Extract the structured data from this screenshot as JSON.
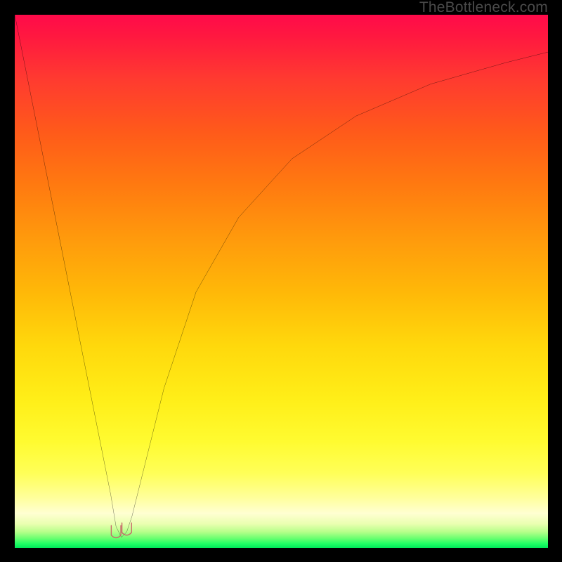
{
  "watermark": {
    "text": "TheBottleneck.com"
  },
  "colors": {
    "frame": "#000000",
    "curve": "#000000",
    "marker": "#c76a6a",
    "gradient_stops": [
      "#ff0a4a",
      "#ff3a30",
      "#ff7a10",
      "#ffb808",
      "#ffee18",
      "#ffff58",
      "#ffffd2",
      "#6aff70",
      "#00e85a"
    ]
  },
  "chart_data": {
    "type": "line",
    "title": "",
    "xlabel": "",
    "ylabel": "",
    "xlim": [
      0,
      100
    ],
    "ylim": [
      0,
      100
    ],
    "grid": false,
    "legend": false,
    "note": "Axes have no visible tick labels; x and y limits inferred as 0–100 plot-relative units. y is percent-like (0 at bottom / green, 100 at top / red). Minimum sits near x≈20.",
    "series": [
      {
        "name": "bottleneck-curve",
        "x": [
          0,
          4,
          8,
          12,
          16,
          18,
          19,
          20,
          21,
          22,
          24,
          28,
          34,
          42,
          52,
          64,
          78,
          92,
          100
        ],
        "y": [
          100,
          80,
          60,
          40,
          20,
          10,
          4,
          2,
          3,
          6,
          14,
          30,
          48,
          62,
          73,
          81,
          87,
          91,
          93
        ]
      }
    ],
    "markers": [
      {
        "name": "min-lobe-left",
        "x": 19.0,
        "y": 2.0
      },
      {
        "name": "min-lobe-right",
        "x": 21.0,
        "y": 2.5
      }
    ]
  }
}
